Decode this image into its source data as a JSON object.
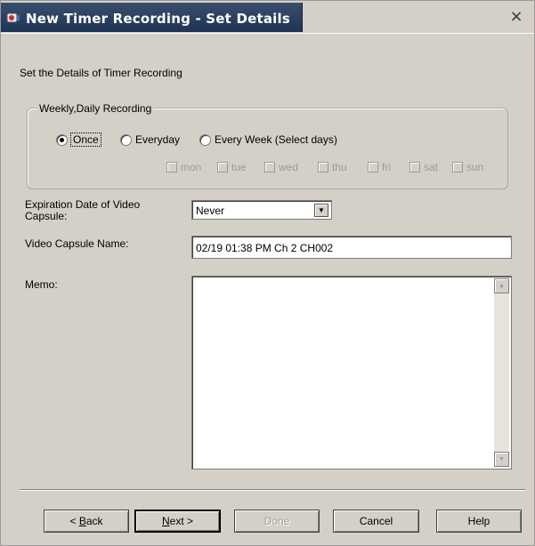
{
  "window": {
    "title": "New Timer Recording - Set Details",
    "close_glyph": "×",
    "app_icon": "app-icon"
  },
  "heading": "Set the Details of Timer Recording",
  "recording": {
    "legend": "Weekly,Daily Recording",
    "options": [
      {
        "label": "Once",
        "selected": true
      },
      {
        "label": "Everyday",
        "selected": false
      },
      {
        "label": "Every Week (Select days)",
        "selected": false
      }
    ],
    "days": [
      "mon",
      "tue",
      "wed",
      "thu",
      "fri",
      "sat",
      "sun"
    ]
  },
  "expiration": {
    "label_line1": "Expiration Date of Video",
    "label_line2": "Capsule:",
    "value": "Never"
  },
  "capsule_name": {
    "label": "Video Capsule Name:",
    "value": "02/19 01:38 PM Ch 2 CH002"
  },
  "memo": {
    "label": "Memo:",
    "value": ""
  },
  "buttons": {
    "back_prefix": "< ",
    "back_key": "B",
    "back_rest": "ack",
    "next_key": "N",
    "next_rest": "ext >",
    "done": "Done",
    "cancel": "Cancel",
    "help": "Help"
  },
  "colors": {
    "titlebar": "#2a3f60",
    "face": "#d4d0c8"
  }
}
